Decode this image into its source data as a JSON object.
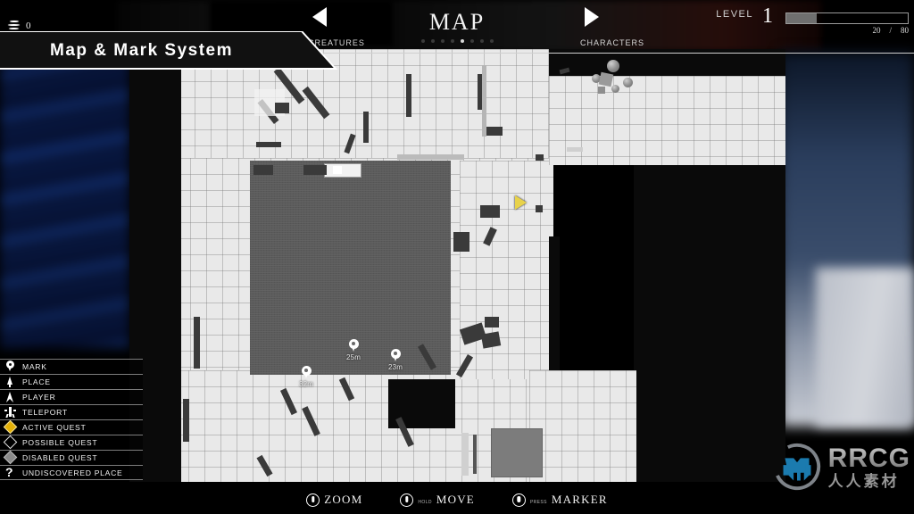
{
  "header": {
    "title": "MAP",
    "left_arrow_icon": "triangle-left-icon",
    "right_arrow_icon": "triangle-right-icon",
    "left_label": "CREATURES",
    "right_label": "CHARACTERS",
    "page_dots": 8,
    "active_dot_index": 4
  },
  "currency": {
    "icon": "coin-stack-icon",
    "value": "0"
  },
  "level": {
    "label": "LEVEL",
    "value": "1",
    "xp_current": "20",
    "xp_separator": "/",
    "xp_max": "80",
    "xp_percent": 25,
    "fill_color": "#6f6f6f"
  },
  "banner": {
    "title": "Map & Mark System"
  },
  "legend": {
    "items": [
      {
        "label": "MARK",
        "icon": "map-pin-icon"
      },
      {
        "label": "PLACE",
        "icon": "tree-icon"
      },
      {
        "label": "PLAYER",
        "icon": "player-arrow-icon"
      },
      {
        "label": "TELEPORT",
        "icon": "teleport-icon"
      },
      {
        "label": "ACTIVE QUEST",
        "icon": "diamond-gold-icon"
      },
      {
        "label": "POSSIBLE QUEST",
        "icon": "diamond-outline-icon"
      },
      {
        "label": "DISABLED QUEST",
        "icon": "diamond-gray-icon"
      },
      {
        "label": "UNDISCOVERED PLACE",
        "icon": "question-mark-icon"
      }
    ]
  },
  "map": {
    "player": {
      "icon": "player-arrow-icon",
      "color": "#e8d24a"
    },
    "markers": [
      {
        "icon": "map-pin-icon",
        "distance": "25m"
      },
      {
        "icon": "map-pin-icon",
        "distance": "23m"
      },
      {
        "icon": "map-pin-icon",
        "distance": "32m"
      }
    ]
  },
  "controls": [
    {
      "icon": "mouse-wheel-icon",
      "modifier": "",
      "label": "ZOOM"
    },
    {
      "icon": "mouse-wheel-icon",
      "modifier": "HOLD",
      "label": "MOVE"
    },
    {
      "icon": "mouse-button-icon",
      "modifier": "PRESS",
      "label": "MARKER"
    }
  ],
  "watermark": {
    "brand": "RRCG",
    "subtitle": "人人素材"
  }
}
